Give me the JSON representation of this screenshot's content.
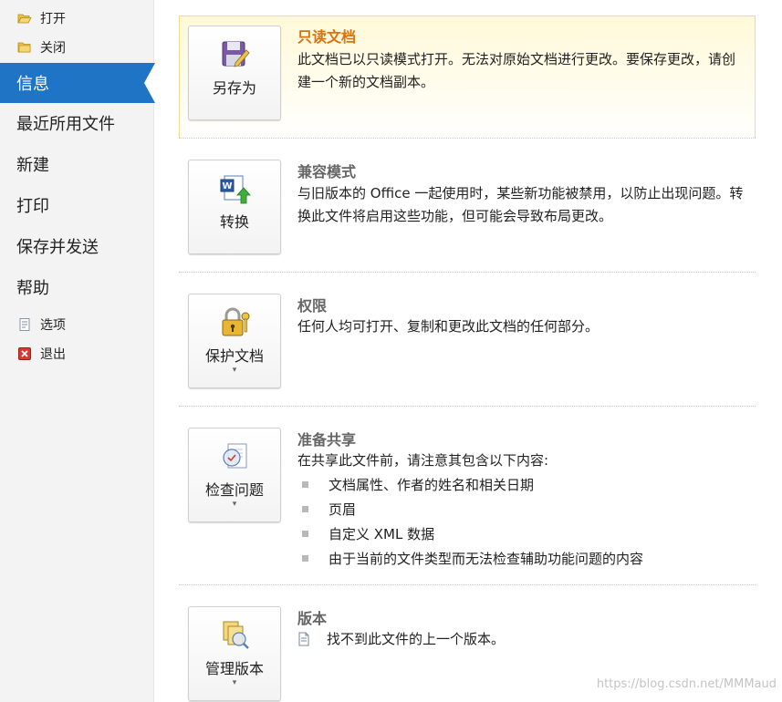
{
  "sidebar": {
    "open": "打开",
    "close": "关闭",
    "info": "信息",
    "recent": "最近所用文件",
    "new": "新建",
    "print": "打印",
    "save_send": "保存并发送",
    "help": "帮助",
    "options": "选项",
    "exit": "退出"
  },
  "sections": {
    "readonly": {
      "button_label": "另存为",
      "title": "只读文档",
      "desc": "此文档已以只读模式打开。无法对原始文档进行更改。要保存更改，请创建一个新的文档副本。"
    },
    "compat": {
      "button_label": "转换",
      "title": "兼容模式",
      "desc": "与旧版本的 Office 一起使用时，某些新功能被禁用，以防止出现问题。转换此文件将启用这些功能，但可能会导致布局更改。"
    },
    "permissions": {
      "button_label": "保护文档",
      "title": "权限",
      "desc": "任何人均可打开、复制和更改此文档的任何部分。"
    },
    "prepare": {
      "button_label": "检查问题",
      "title": "准备共享",
      "desc": "在共享此文件前，请注意其包含以下内容:",
      "items": [
        "文档属性、作者的姓名和相关日期",
        "页眉",
        "自定义 XML 数据",
        "由于当前的文件类型而无法检查辅助功能问题的内容"
      ]
    },
    "versions": {
      "button_label": "管理版本",
      "title": "版本",
      "desc": "找不到此文件的上一个版本。"
    }
  },
  "caret": "▾",
  "watermark": "https://blog.csdn.net/MMMaud",
  "colors": {
    "accent": "#1f74c6",
    "title_orange": "#d9730d",
    "highlight_bg": "#fff9d8"
  }
}
